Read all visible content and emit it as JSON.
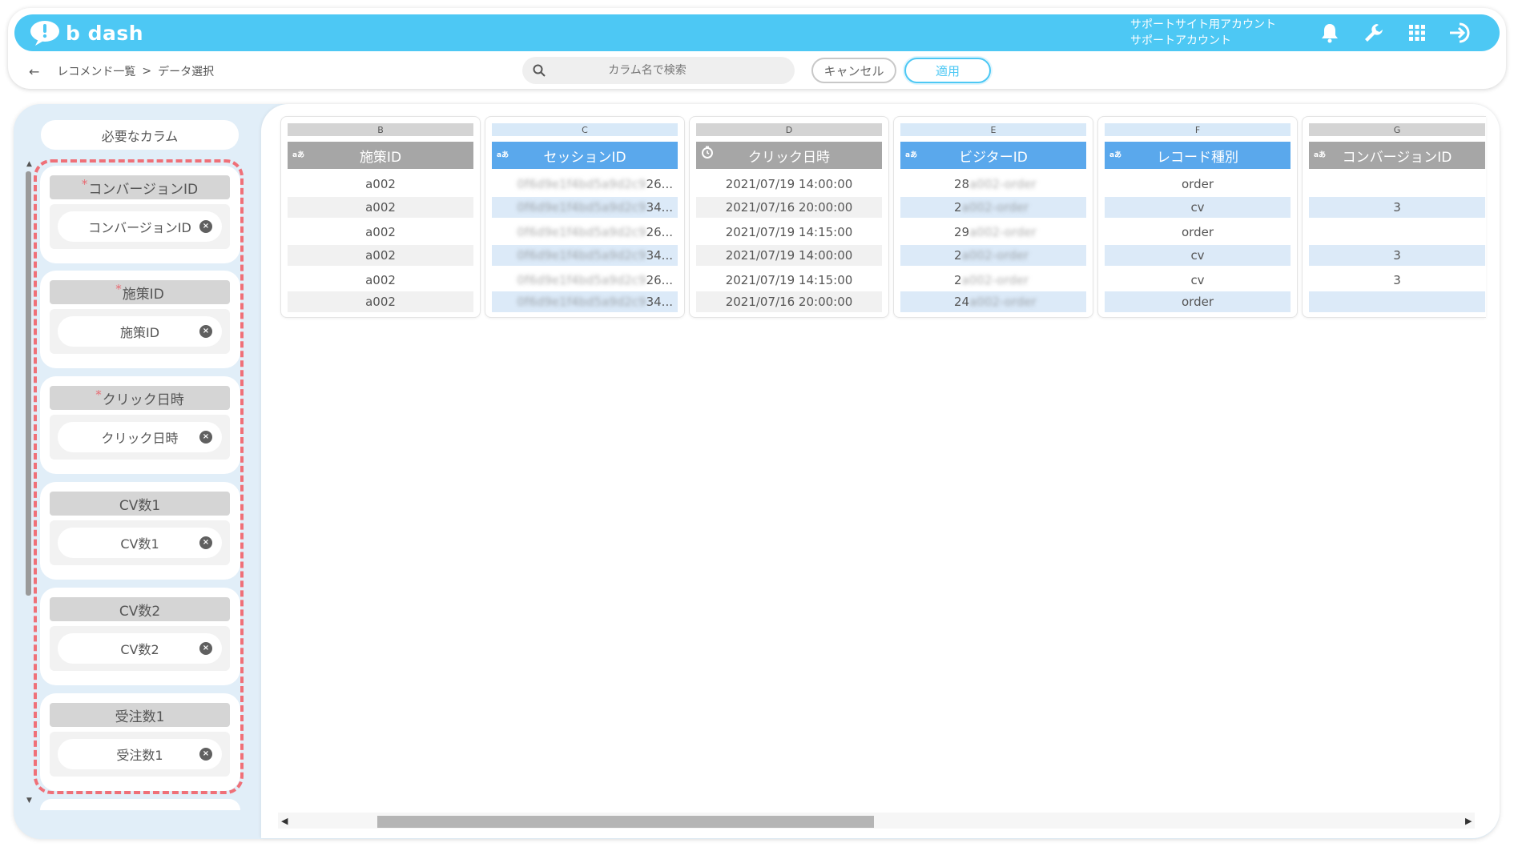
{
  "header": {
    "logo_text": "b dash",
    "account_line1": "サポートサイト用アカウント",
    "account_line2": "サポートアカウント",
    "icons": [
      "bell-icon",
      "wrench-icon",
      "grid-icon",
      "logout-icon"
    ],
    "color_accent": "#4dc8f4"
  },
  "toolbar": {
    "back_icon": "arrow-left-icon",
    "breadcrumb_1": "レコメンド一覧",
    "breadcrumb_sep": ">",
    "breadcrumb_2": "データ選択",
    "search_placeholder": "カラム名で検索",
    "cancel_label": "キャンセル",
    "apply_label": "適用"
  },
  "required": {
    "title": "必要なカラム",
    "slots": [
      {
        "label": "コンバージョンID",
        "required_mark": "*",
        "chip": "コンバージョンID"
      },
      {
        "label": "施策ID",
        "required_mark": "*",
        "chip": "施策ID"
      },
      {
        "label": "クリック日時",
        "required_mark": "*",
        "chip": "クリック日時"
      },
      {
        "label": "CV数1",
        "required_mark": "",
        "chip": "CV数1"
      },
      {
        "label": "CV数2",
        "required_mark": "",
        "chip": "CV数2"
      },
      {
        "label": "受注数1",
        "required_mark": "",
        "chip": "受注数1"
      }
    ],
    "highlight_color": "#ef7078"
  },
  "type_icon_text": "aあ",
  "columns": [
    {
      "letter": "B",
      "name": "施策ID",
      "selected": false,
      "type": "text",
      "cells": [
        "a002",
        "a002",
        "a002",
        "a002",
        "a002",
        "a002"
      ]
    },
    {
      "letter": "C",
      "name": "セッションID",
      "selected": true,
      "type": "text",
      "cells": [
        "26...",
        "34...",
        "26...",
        "34...",
        "26...",
        "34..."
      ]
    },
    {
      "letter": "D",
      "name": "クリック日時",
      "selected": false,
      "type": "datetime",
      "cells": [
        "2021/07/19 14:00:00",
        "2021/07/16 20:00:00",
        "2021/07/19 14:15:00",
        "2021/07/19 14:00:00",
        "2021/07/19 14:15:00",
        "2021/07/16 20:00:00"
      ]
    },
    {
      "letter": "E",
      "name": "ビジターID",
      "selected": true,
      "type": "text",
      "cells": [
        "28",
        "2",
        "29",
        "2",
        "2",
        "24"
      ]
    },
    {
      "letter": "F",
      "name": "レコード種別",
      "selected": true,
      "type": "text",
      "cells": [
        "order",
        "cv",
        "order",
        "cv",
        "cv",
        "order"
      ]
    },
    {
      "letter": "G",
      "name": "コンバージョンID",
      "selected": false,
      "type": "text",
      "cells": [
        "",
        "3",
        "",
        "3",
        "3",
        ""
      ]
    }
  ]
}
